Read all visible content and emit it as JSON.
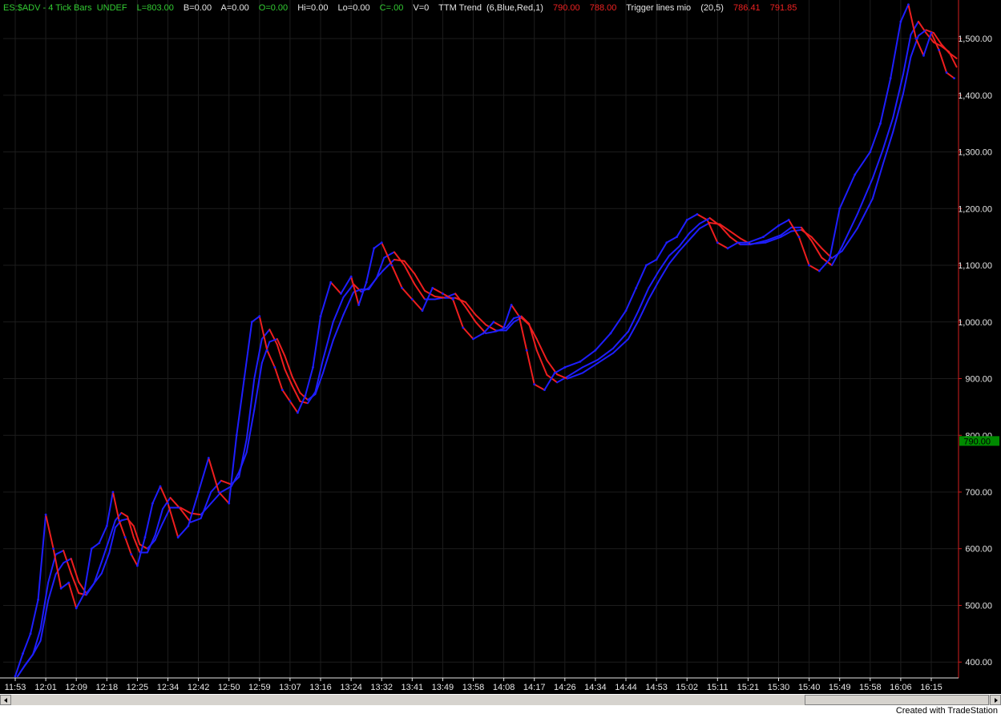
{
  "header": {
    "symbol": "ES:$ADV - 4 Tick Bars",
    "status": "UNDEF",
    "last": "L=803.00",
    "bid": "B=0.00",
    "ask": "A=0.00",
    "open": "O=0.00",
    "high": "Hi=0.00",
    "low": "Lo=0.00",
    "close": "C=.00",
    "volume": "V=0",
    "indicator1_name": "TTM Trend",
    "indicator1_params": "(6,Blue,Red,1)",
    "indicator1_v1": "790.00",
    "indicator1_v2": "788.00",
    "indicator2_name": "Trigger lines mio",
    "indicator2_params": "(20,5)",
    "indicator2_v1": "786.41",
    "indicator2_v2": "791.85"
  },
  "footer": {
    "credit": "Created with TradeStation"
  },
  "colors": {
    "background": "#000000",
    "grid": "#1d1d1d",
    "axis_line": "#d21e1e",
    "axis_text": "#e6e6e6",
    "up_color": "#1e1eff",
    "down_color": "#ee1e1e",
    "last_price_marker": "#008a00"
  },
  "chart_data": {
    "type": "line",
    "title": "ES:$ADV - 4 Tick Bars",
    "xlabel": "",
    "ylabel": "",
    "x_tick_labels": [
      "11:53",
      "12:01",
      "12:09",
      "12:18",
      "12:25",
      "12:34",
      "12:42",
      "12:50",
      "12:59",
      "13:07",
      "13:16",
      "13:24",
      "13:32",
      "13:41",
      "13:49",
      "13:58",
      "14:08",
      "14:17",
      "14:26",
      "14:34",
      "14:44",
      "14:53",
      "15:02",
      "15:11",
      "15:21",
      "15:30",
      "15:40",
      "15:49",
      "15:58",
      "16:06",
      "16:15"
    ],
    "y_ticks": [
      400,
      500,
      600,
      700,
      800,
      900,
      1000,
      1100,
      1200,
      1300,
      1400,
      1500
    ],
    "y_tick_labels": [
      "400.00",
      "500.00",
      "600.00",
      "700.00",
      "800.00",
      "900.00",
      "1,000.00",
      "1,100.00",
      "1,200.00",
      "1,300.00",
      "1,400.00",
      "1,500.00"
    ],
    "ylim": [
      372,
      1568
    ],
    "grid": true,
    "last_price_label": "790.00",
    "last_price_value": 790,
    "series": [
      {
        "name": "TTM Trend",
        "colored_by_trend": true,
        "points": [
          [
            "11:53",
            375
          ],
          [
            "11:53",
            415
          ],
          [
            "11:53",
            450
          ],
          [
            "11:53",
            510
          ],
          [
            "12:01",
            660
          ],
          [
            "12:01",
            600
          ],
          [
            "12:01",
            530
          ],
          [
            "12:01",
            540
          ],
          [
            "12:09",
            495
          ],
          [
            "12:09",
            520
          ],
          [
            "12:09",
            600
          ],
          [
            "12:09",
            610
          ],
          [
            "12:18",
            640
          ],
          [
            "12:18",
            700
          ],
          [
            "12:18",
            650
          ],
          [
            "12:18",
            620
          ],
          [
            "12:18",
            590
          ],
          [
            "12:25",
            570
          ],
          [
            "12:25",
            620
          ],
          [
            "12:25",
            680
          ],
          [
            "12:25",
            710
          ],
          [
            "12:34",
            680
          ],
          [
            "12:34",
            620
          ],
          [
            "12:34",
            640
          ],
          [
            "12:42",
            700
          ],
          [
            "12:42",
            760
          ],
          [
            "12:42",
            700
          ],
          [
            "12:50",
            680
          ],
          [
            "12:50",
            800
          ],
          [
            "12:50",
            900
          ],
          [
            "12:50",
            1000
          ],
          [
            "12:59",
            1010
          ],
          [
            "12:59",
            950
          ],
          [
            "12:59",
            920
          ],
          [
            "12:59",
            880
          ],
          [
            "13:07",
            860
          ],
          [
            "13:07",
            840
          ],
          [
            "13:07",
            870
          ],
          [
            "13:07",
            920
          ],
          [
            "13:16",
            1010
          ],
          [
            "13:16",
            1070
          ],
          [
            "13:16",
            1050
          ],
          [
            "13:24",
            1080
          ],
          [
            "13:24",
            1030
          ],
          [
            "13:24",
            1070
          ],
          [
            "13:24",
            1130
          ],
          [
            "13:32",
            1140
          ],
          [
            "13:32",
            1100
          ],
          [
            "13:32",
            1060
          ],
          [
            "13:41",
            1040
          ],
          [
            "13:41",
            1020
          ],
          [
            "13:41",
            1060
          ],
          [
            "13:49",
            1050
          ],
          [
            "13:49",
            1040
          ],
          [
            "13:49",
            990
          ],
          [
            "13:58",
            970
          ],
          [
            "13:58",
            980
          ],
          [
            "13:58",
            1000
          ],
          [
            "14:08",
            990
          ],
          [
            "14:08",
            1030
          ],
          [
            "14:08",
            1010
          ],
          [
            "14:08",
            950
          ],
          [
            "14:17",
            890
          ],
          [
            "14:17",
            880
          ],
          [
            "14:17",
            910
          ],
          [
            "14:26",
            920
          ],
          [
            "14:26",
            930
          ],
          [
            "14:34",
            950
          ],
          [
            "14:34",
            980
          ],
          [
            "14:44",
            1020
          ],
          [
            "14:44",
            1060
          ],
          [
            "14:44",
            1100
          ],
          [
            "14:53",
            1110
          ],
          [
            "14:53",
            1140
          ],
          [
            "14:53",
            1150
          ],
          [
            "15:02",
            1180
          ],
          [
            "15:02",
            1190
          ],
          [
            "15:02",
            1180
          ],
          [
            "15:11",
            1140
          ],
          [
            "15:11",
            1130
          ],
          [
            "15:11",
            1140
          ],
          [
            "15:21",
            1140
          ],
          [
            "15:21",
            1150
          ],
          [
            "15:30",
            1170
          ],
          [
            "15:30",
            1180
          ],
          [
            "15:30",
            1150
          ],
          [
            "15:40",
            1100
          ],
          [
            "15:40",
            1090
          ],
          [
            "15:40",
            1110
          ],
          [
            "15:49",
            1200
          ],
          [
            "15:49",
            1260
          ],
          [
            "15:58",
            1300
          ],
          [
            "15:58",
            1350
          ],
          [
            "15:58",
            1430
          ],
          [
            "16:06",
            1530
          ],
          [
            "16:06",
            1560
          ],
          [
            "16:06",
            1500
          ],
          [
            "16:06",
            1470
          ],
          [
            "16:15",
            1510
          ],
          [
            "16:15",
            1480
          ],
          [
            "16:15",
            1440
          ],
          [
            "16:15",
            1430
          ]
        ]
      }
    ]
  }
}
